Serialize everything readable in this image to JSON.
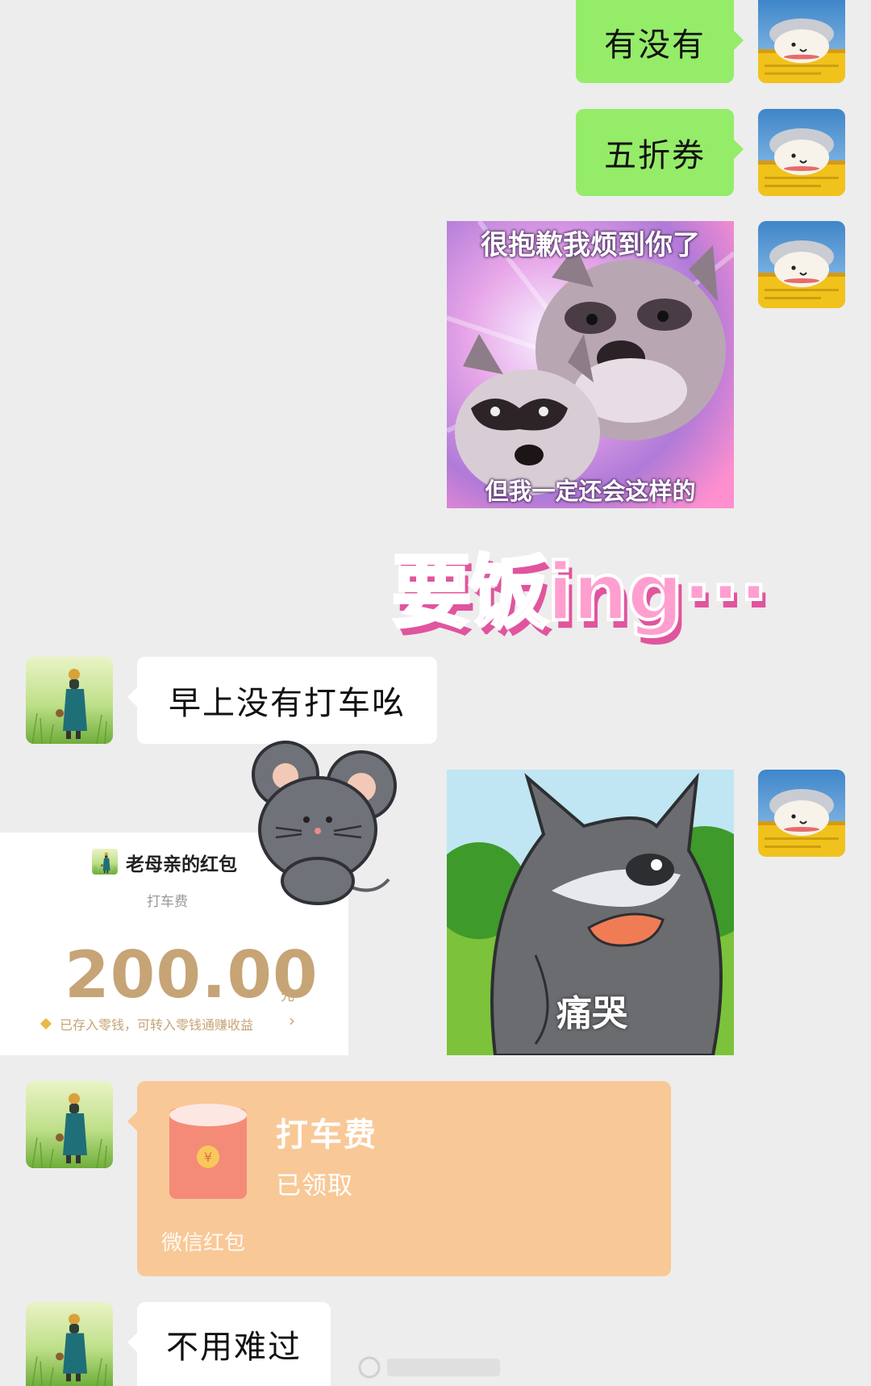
{
  "messages": {
    "m1_text": "有没有",
    "m2_text": "五折券",
    "m3_sticker_top": "很抱歉我烦到你了",
    "m3_sticker_bottom": "但我一定还会这样的",
    "m4_sticker_text": "要饭ing···",
    "m5_text": "早上没有打车吆",
    "m6_sticker_text": "痛哭",
    "m9_text": "不用难过"
  },
  "red_packet_received": {
    "sender": "老母亲的红包",
    "memo": "打车费",
    "amount": "200.00",
    "unit": "元",
    "note": "已存入零钱，可转入零钱通赚收益"
  },
  "hongbao_bubble": {
    "title": "打车费",
    "status": "已领取",
    "footer": "微信红包"
  },
  "colors": {
    "background": "#ededed",
    "my_bubble": "#95ec69",
    "their_bubble": "#ffffff",
    "hongbao_opened": "#f9c897",
    "amount_gold": "#c6a476",
    "sticker_pink": "#ff7fc0"
  }
}
